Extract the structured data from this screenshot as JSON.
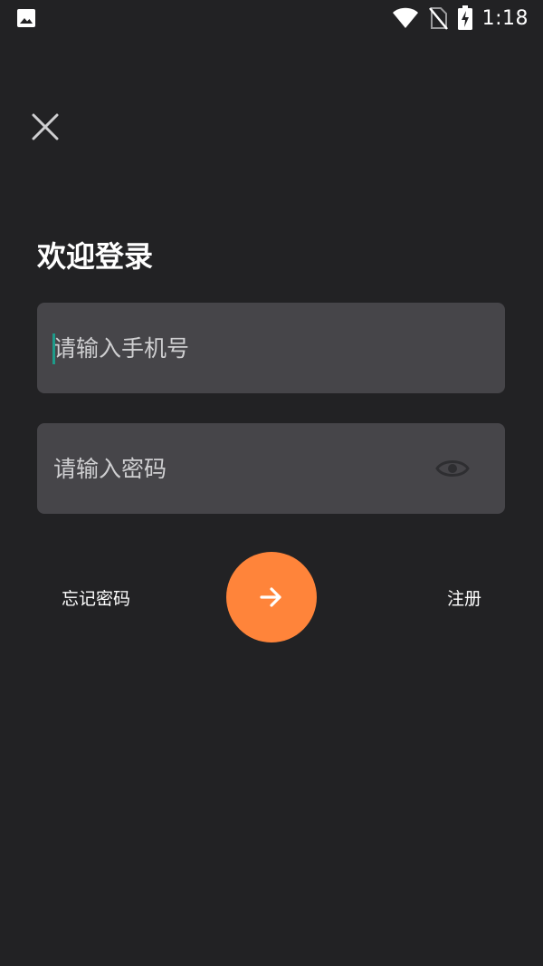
{
  "status_bar": {
    "time": "1:18",
    "icons": [
      "image-icon",
      "wifi-icon",
      "no-sim-icon",
      "battery-charging-icon"
    ]
  },
  "header": {
    "close_icon": "close-icon"
  },
  "login": {
    "title": "欢迎登录",
    "phone_placeholder": "请输入手机号",
    "phone_value": "",
    "password_placeholder": "请输入密码",
    "password_value": "",
    "eye_icon": "eye-icon",
    "forgot_label": "忘记密码",
    "register_label": "注册",
    "submit_icon": "arrow-right-icon"
  },
  "colors": {
    "background": "#222224",
    "field_background": "#464549",
    "accent": "#ff843a",
    "cursor": "#1e9b8a",
    "text": "#ffffff"
  }
}
